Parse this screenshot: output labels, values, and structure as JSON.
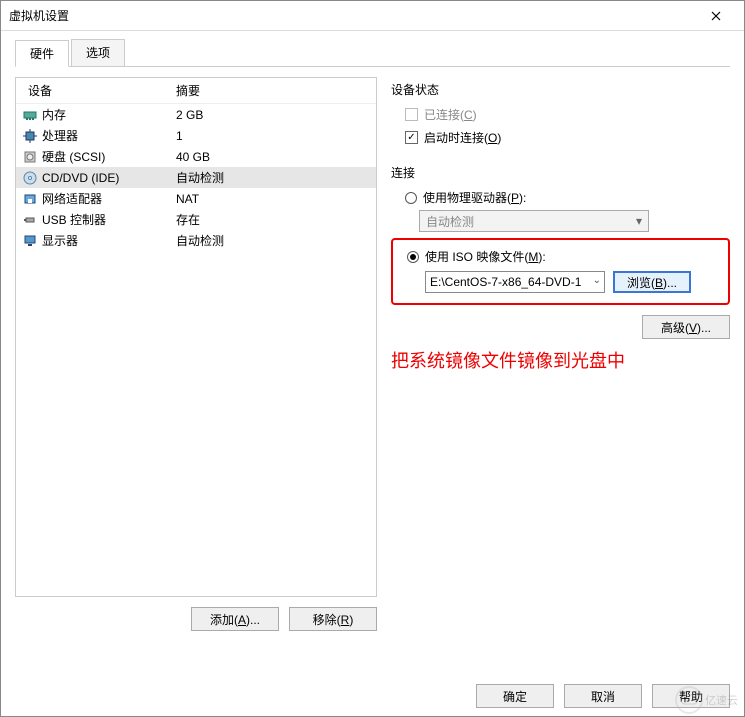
{
  "window": {
    "title": "虚拟机设置"
  },
  "tabs": {
    "hardware": "硬件",
    "options": "选项"
  },
  "device_list": {
    "header_device": "设备",
    "header_summary": "摘要",
    "rows": [
      {
        "icon": "memory-icon",
        "name": "内存",
        "value": "2 GB"
      },
      {
        "icon": "cpu-icon",
        "name": "处理器",
        "value": "1"
      },
      {
        "icon": "disk-icon",
        "name": "硬盘 (SCSI)",
        "value": "40 GB"
      },
      {
        "icon": "cd-icon",
        "name": "CD/DVD (IDE)",
        "value": "自动检测",
        "selected": true
      },
      {
        "icon": "nic-icon",
        "name": "网络适配器",
        "value": "NAT"
      },
      {
        "icon": "usb-icon",
        "name": "USB 控制器",
        "value": "存在"
      },
      {
        "icon": "display-icon",
        "name": "显示器",
        "value": "自动检测"
      }
    ]
  },
  "buttons": {
    "add": "添加(A)...",
    "remove": "移除(R)",
    "ok": "确定",
    "cancel": "取消",
    "help": "帮助",
    "browse": "浏览(B)...",
    "advanced": "高级(V)..."
  },
  "right": {
    "status_title": "设备状态",
    "connected": "已连接(C)",
    "connect_at_power_on": "启动时连接(O)",
    "connection_title": "连接",
    "use_physical": "使用物理驱动器(P):",
    "physical_value": "自动检测",
    "use_iso": "使用 ISO 映像文件(M):",
    "iso_path": "E:\\CentOS-7-x86_64-DVD-1"
  },
  "annotation": "把系统镜像文件镜像到光盘中",
  "watermark": "亿速云"
}
